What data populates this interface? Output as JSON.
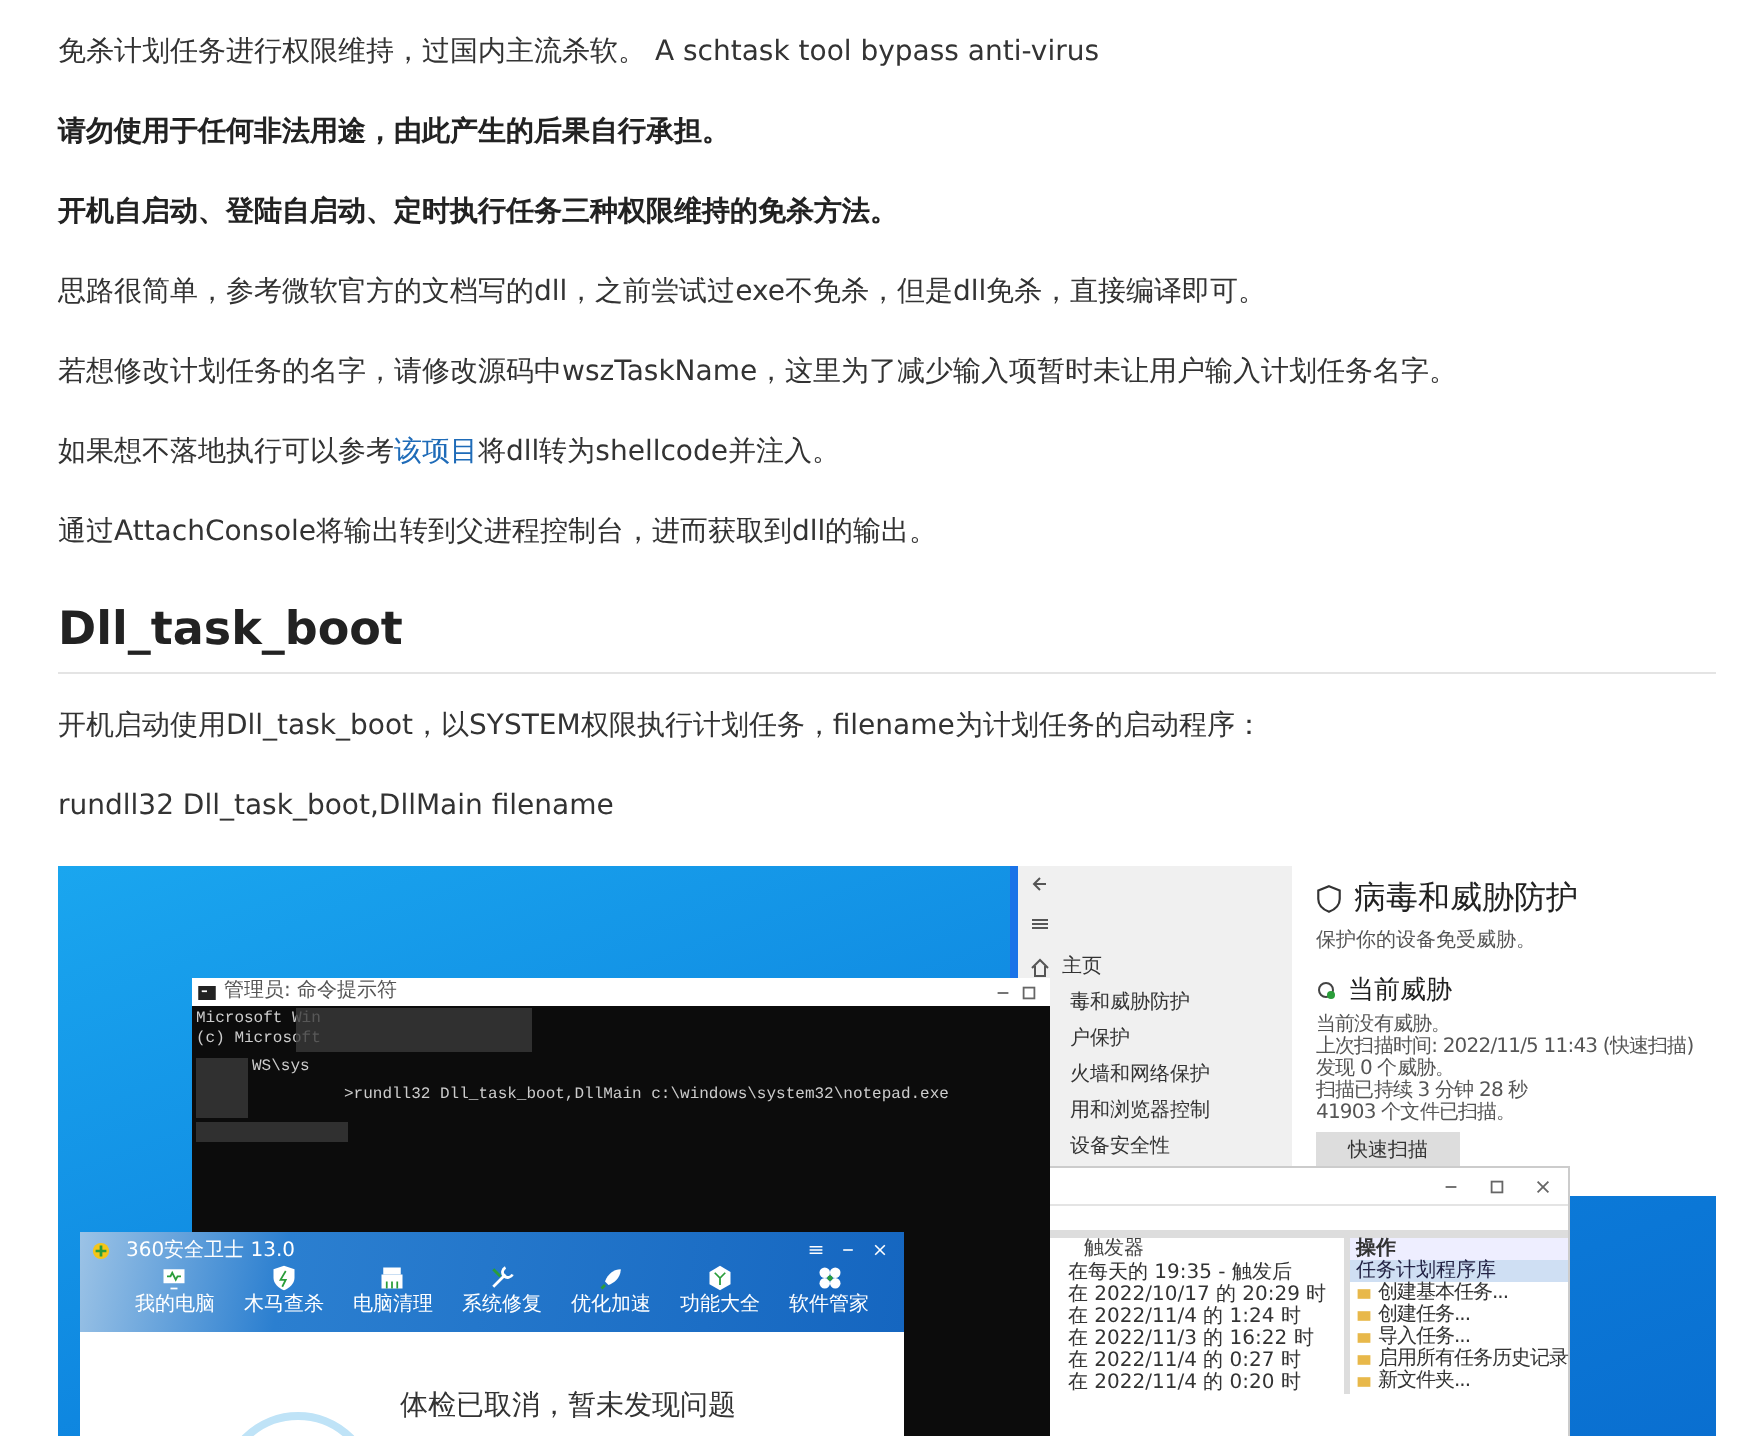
{
  "paragraphs": [
    {
      "kind": "plain",
      "text": "免杀计划任务进行权限维持，过国内主流杀软。 A schtask tool bypass anti-virus"
    },
    {
      "kind": "bold",
      "text": "请勿使用于任何非法用途，由此产生的后果自行承担。"
    },
    {
      "kind": "bold",
      "text": "开机自启动、登陆自启动、定时执行任务三种权限维持的免杀方法。"
    },
    {
      "kind": "plain",
      "text": "思路很简单，参考微软官方的文档写的dll，之前尝试过exe不免杀，但是dll免杀，直接编译即可。"
    },
    {
      "kind": "plain",
      "text": "若想修改计划任务的名字，请修改源码中wszTaskName，这里为了减少输入项暂时未让用户输入计划任务名字。"
    },
    {
      "kind": "link",
      "before": "如果想不落地执行可以参考",
      "link": "该项目",
      "after": "将dll转为shellcode并注入。"
    },
    {
      "kind": "plain",
      "text": "通过AttachConsole将输出转到父进程控制台，进而获取到dll的输出。"
    }
  ],
  "heading": "Dll_task_boot",
  "section_paragraphs": [
    "开机启动使用Dll_task_boot，以SYSTEM权限执行计划任务，filename为计划任务的启动程序：",
    "rundll32 Dll_task_boot,DllMain filename"
  ],
  "screenshot": {
    "security_window": {
      "nav_home": "主页",
      "nav_items": [
        "毒和威胁防护",
        "户保护",
        "火墙和网络保护",
        "用和浏览器控制",
        "设备安全性"
      ],
      "title": "病毒和威胁防护",
      "subtitle": "保护你的设备免受威胁。",
      "section_title": "当前威胁",
      "status_lines": [
        "当前没有威胁。",
        "上次扫描时间: 2022/11/5 11:43 (快速扫描)",
        "发现 0 个威胁。",
        "扫描已持续 3 分钟 28 秒",
        "41903 个文件已扫描。"
      ],
      "scan_button": "快速扫描"
    },
    "console_window": {
      "title": "管理员: 命令提示符",
      "lines": [
        "Microsoft Win",
        "(c) Microsoft",
        "WS\\sys"
      ],
      "command": ">rundll32 Dll_task_boot,DllMain c:\\windows\\system32\\notepad.exe"
    },
    "scheduler_window": {
      "trigger_column": "触发器",
      "rows": [
        "在每天的 19:35 - 触发后",
        "在 2022/10/17 的 20:29 时",
        "在 2022/11/4 的 1:24 时",
        "在 2022/11/3 的 16:22 时",
        "在 2022/11/4 的 0:27 时",
        "在 2022/11/4 的 0:20 时"
      ],
      "actions_title": "操作",
      "actions_group": "任务计划程序库",
      "actions": [
        "创建基本任务...",
        "创建任务...",
        "导入任务...",
        "启用所有任务历史记录",
        "新文件夹..."
      ]
    },
    "guard_window": {
      "title": "360安全卫士 13.0",
      "tabs": [
        "我的电脑",
        "木马查杀",
        "电脑清理",
        "系统修复",
        "优化加速",
        "功能大全",
        "软件管家"
      ],
      "message": "体检已取消，暂未发现问题"
    }
  }
}
